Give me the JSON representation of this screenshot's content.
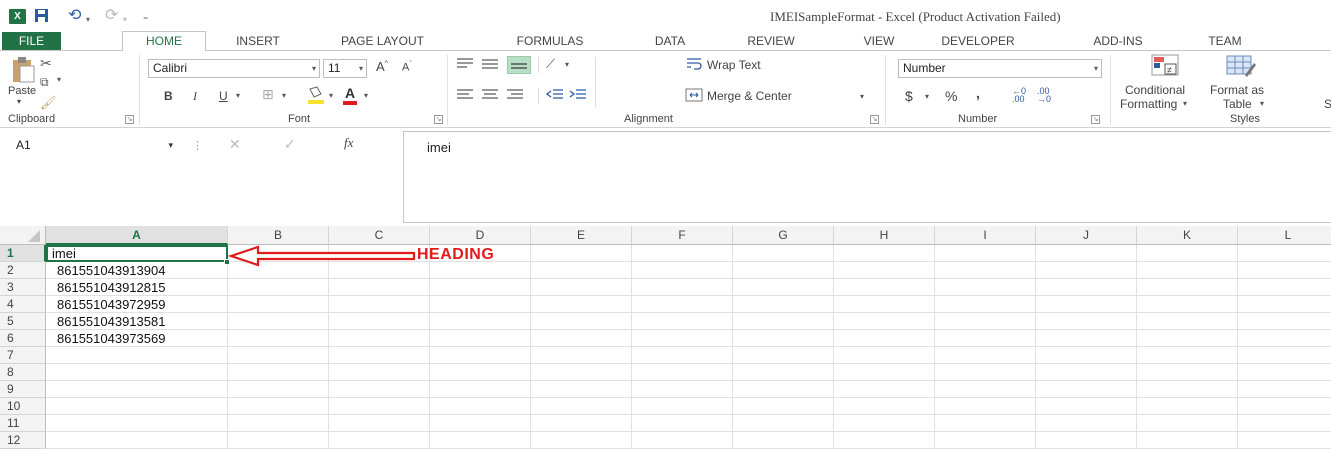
{
  "app": {
    "logo": "X",
    "title": "IMEISampleFormat - Excel (Product Activation Failed)"
  },
  "tabs": [
    "FILE",
    "HOME",
    "INSERT",
    "PAGE LAYOUT",
    "FORMULAS",
    "DATA",
    "REVIEW",
    "VIEW",
    "DEVELOPER",
    "ADD-INS",
    "TEAM"
  ],
  "ribbon": {
    "clipboard": {
      "paste": "Paste",
      "label": "Clipboard"
    },
    "font": {
      "name": "Calibri",
      "size": "11",
      "label": "Font",
      "bold": "B",
      "italic": "I",
      "underline": "U",
      "font_color_letter": "A"
    },
    "alignment": {
      "wrap": "Wrap Text",
      "merge": "Merge & Center",
      "label": "Alignment"
    },
    "number": {
      "format": "Number",
      "currency": "$",
      "percent": "%",
      "comma": ",",
      "label": "Number"
    },
    "styles": {
      "conditional_line1": "Conditional",
      "conditional_line2": "Formatting",
      "format_as_line1": "Format as",
      "format_as_line2": "Table",
      "label": "Styles",
      "cut_letter": "S"
    }
  },
  "formula_bar": {
    "name_box": "A1",
    "fx": "fx",
    "value": "imei"
  },
  "grid": {
    "columns": [
      "A",
      "B",
      "C",
      "D",
      "E",
      "F",
      "G",
      "H",
      "I",
      "J",
      "K",
      "L"
    ],
    "rows": [
      "1",
      "2",
      "3",
      "4",
      "5",
      "6",
      "7",
      "8",
      "9",
      "10",
      "11",
      "12"
    ],
    "col_a_values": [
      "imei",
      "861551043913904",
      "861551043912815",
      "861551043972959",
      "861551043913581",
      "861551043973569",
      "",
      "",
      "",
      "",
      "",
      ""
    ]
  },
  "annotation": {
    "text": "HEADING",
    "color": "#e01b1b"
  },
  "colors": {
    "accent": "#217346"
  }
}
